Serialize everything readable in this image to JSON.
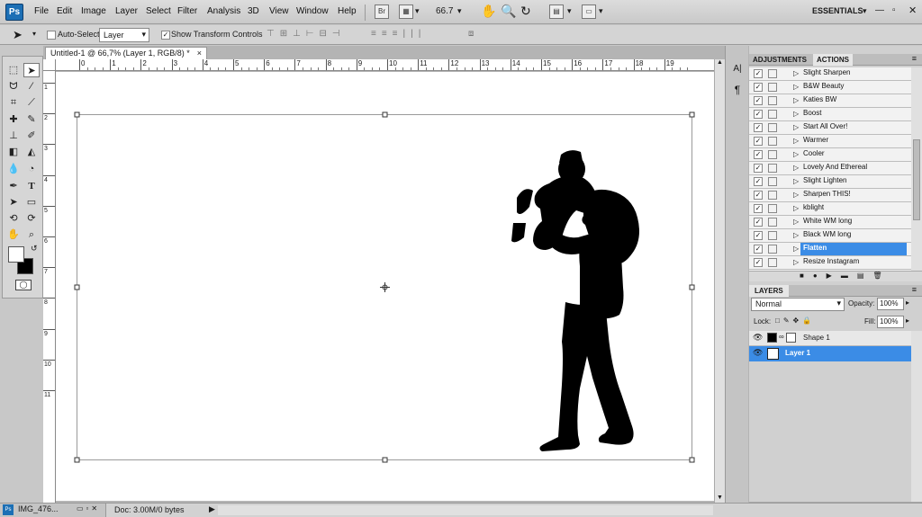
{
  "app": {
    "logo": "Ps",
    "workspace": "ESSENTIALS"
  },
  "menu": [
    "File",
    "Edit",
    "Image",
    "Layer",
    "Select",
    "Filter",
    "Analysis",
    "3D",
    "View",
    "Window",
    "Help"
  ],
  "toolbar": {
    "zoom": "66.7",
    "bridge_label": "Br"
  },
  "options": {
    "auto_select_label": "Auto-Select:",
    "layer_select": "Layer",
    "show_transform_label": "Show Transform Controls"
  },
  "document": {
    "tab_title": "Untitled-1 @ 66,7% (Layer 1, RGB/8) *"
  },
  "ruler": {
    "h_ticks": [
      "0",
      "1",
      "2",
      "3",
      "4",
      "5",
      "6",
      "7",
      "8",
      "9",
      "10",
      "11",
      "12",
      "13",
      "14",
      "15",
      "16",
      "17",
      "18",
      "19"
    ],
    "v_ticks": [
      "1",
      "2",
      "3",
      "4",
      "5",
      "6",
      "7",
      "8",
      "9",
      "10",
      "11"
    ]
  },
  "panels": {
    "adjustments_tab": "ADJUSTMENTS",
    "actions_tab": "ACTIONS",
    "actions": [
      "Slight Sharpen",
      "B&W Beauty",
      "Katies BW",
      "Boost",
      "Start All Over!",
      "Warmer",
      "Cooler",
      "Lovely And Ethereal",
      "Slight Lighten",
      "Sharpen THIS!",
      "kblight",
      "White WM long",
      "Black WM long",
      "Flatten",
      "Resize Instagram"
    ],
    "layers_tab": "LAYERS",
    "blend_mode": "Normal",
    "opacity_label": "Opacity:",
    "opacity": "100%",
    "lock_label": "Lock:",
    "fill_label": "Fill:",
    "fill": "100%",
    "layers": [
      {
        "name": "Shape 1",
        "selected": false
      },
      {
        "name": "Layer 1",
        "selected": true
      }
    ]
  },
  "status": {
    "doc_info": "Doc: 3.00M/0 bytes",
    "minimized_doc": "IMG_476..."
  }
}
